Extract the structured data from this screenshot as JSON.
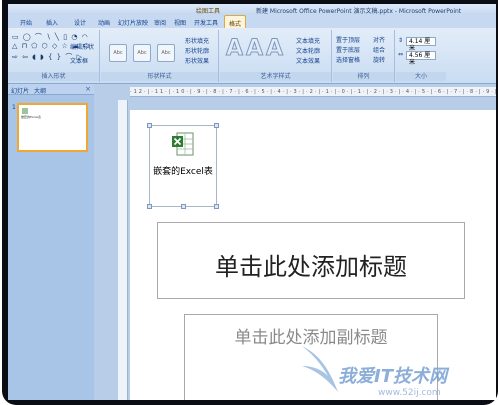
{
  "titlebar": {
    "context_label": "绘图工具",
    "title": "新建 Microsoft Office PowerPoint 演示文稿.pptx - Microsoft PowerPoint"
  },
  "tabs": [
    "开始",
    "插入",
    "设计",
    "动画",
    "幻灯片放映",
    "审阅",
    "视图",
    "开发工具",
    "格式"
  ],
  "active_tab": "格式",
  "ribbon": {
    "insert_shapes": {
      "row1": "▭ ◯ ⌒ ∖ ╲ ▯ ◔ ◠",
      "row2": "△ ⊓ ⬠ ⬡ ◇ ☆ ☁ ⬭",
      "row3": "⇨ ⇦ ◖ ◗ { } ⌒ ▷",
      "edit_shape": "编辑形状",
      "textbox": "文本框",
      "label": "插入形状"
    },
    "shape_styles": {
      "box_text": "Abc",
      "fill": "形状填充",
      "outline": "形状轮廓",
      "effects": "形状效果",
      "label": "形状样式"
    },
    "wordart": {
      "letter": "A",
      "text_fill": "文本填充",
      "text_outline": "文本轮廓",
      "text_effects": "文本效果",
      "label": "艺术字样式"
    },
    "arrange": {
      "bring_front": "置于顶层",
      "send_back": "置于底层",
      "selection_pane": "选择窗格",
      "align": "对齐",
      "group": "组合",
      "rotate": "旋转",
      "label": "排列"
    },
    "size": {
      "height": "4.14 厘米",
      "width": "4.56 厘米",
      "label": "大小"
    }
  },
  "pane": {
    "tab_slides": "幻灯片",
    "tab_outline": "大纲",
    "close": "×",
    "slide_number": "1",
    "thumb_text": "嵌套的Excel表"
  },
  "ruler": {
    "h_ticks": "·12·|·11·|·10·|·9·|·8·|·7·|·6·|·5·|·4·|·3·|·2·|·1·|·0·|·1·|·2·|·3·|·4·|·5·|·6·|·7·|·8·|·9·|·10"
  },
  "slide": {
    "embedded_object_label": "嵌套的Excel表",
    "title_placeholder": "单击此处添加标题",
    "subtitle_placeholder": "单击此处添加副标题"
  },
  "watermark": {
    "text": "我爱IT技术网",
    "url": "www.52ij.com"
  },
  "colors": {
    "ribbon_bg": "#c9dcf2",
    "active_tab": "#fdf4d9",
    "context_tab": "#f4b54a",
    "selection_border": "#f0a830",
    "pane_bg": "#a8c4e6"
  }
}
